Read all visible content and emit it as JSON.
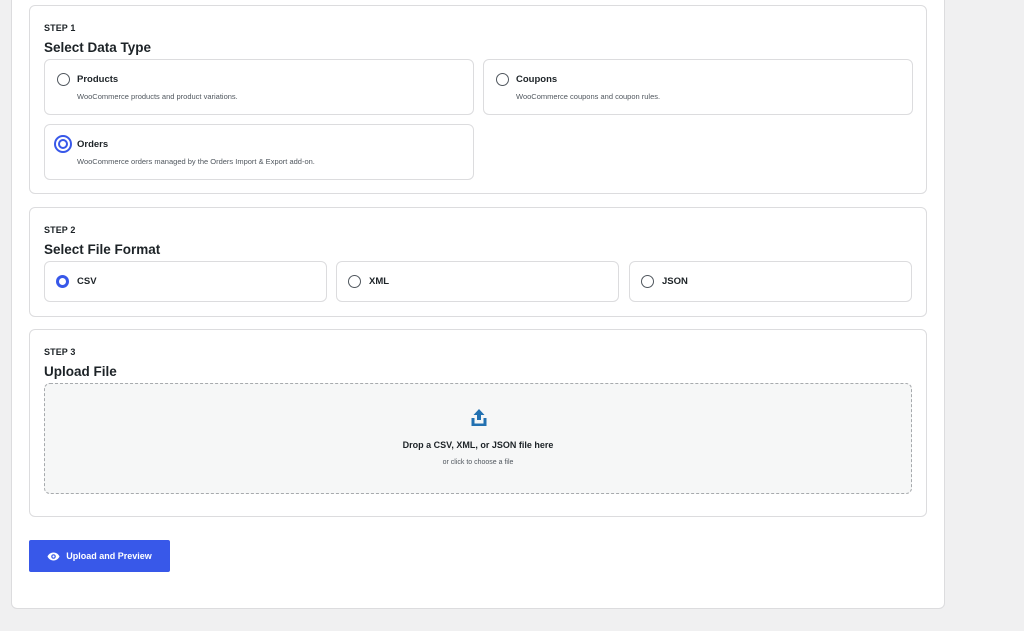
{
  "step1": {
    "label": "STEP 1",
    "title": "Select Data Type",
    "options": [
      {
        "title": "Products",
        "desc": "WooCommerce products and product variations.",
        "selected": false
      },
      {
        "title": "Coupons",
        "desc": "WooCommerce coupons and coupon rules.",
        "selected": false
      },
      {
        "title": "Orders",
        "desc": "WooCommerce orders managed by the Orders Import & Export add-on.",
        "selected": true
      }
    ]
  },
  "step2": {
    "label": "STEP 2",
    "title": "Select File Format",
    "options": [
      {
        "title": "CSV",
        "selected": true
      },
      {
        "title": "XML",
        "selected": false
      },
      {
        "title": "JSON",
        "selected": false
      }
    ]
  },
  "step3": {
    "label": "STEP 3",
    "title": "Upload File",
    "drop_main": "Drop a CSV, XML, or JSON file here",
    "drop_sub": "or click to choose a file",
    "icon": "upload-icon"
  },
  "actions": {
    "upload_preview_label": "Upload and Preview",
    "upload_preview_icon": "eye-icon"
  },
  "colors": {
    "accent": "#3858e9",
    "border": "#dcdcde",
    "page_bg": "#f0f0f1",
    "upload_icon": "#2271b1"
  }
}
